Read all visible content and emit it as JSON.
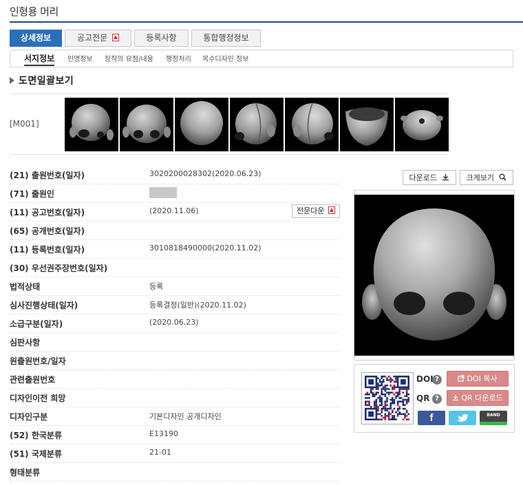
{
  "page": {
    "title": "인형용 머리"
  },
  "tabs": [
    {
      "label": "상세정보",
      "active": true
    },
    {
      "label": "공고전문",
      "has_pdf": true
    },
    {
      "label": "등록사항"
    },
    {
      "label": "통합행정정보"
    }
  ],
  "subnav": [
    {
      "label": "서지정보",
      "active": true
    },
    {
      "label": "인명정보"
    },
    {
      "label": "창작의 요점/내용"
    },
    {
      "label": "행정처리"
    },
    {
      "label": "복수디자인 정보"
    }
  ],
  "drawings": {
    "heading": "도면일괄보기",
    "label": "[M001]",
    "views": [
      "top-right",
      "front-top",
      "back",
      "right-side",
      "left-side",
      "top-down",
      "bottom"
    ]
  },
  "info": [
    {
      "label": "(21) 출원번호(일자)",
      "value": "3020200028302(2020.06.23)"
    },
    {
      "label": "(71) 출원인",
      "value": "",
      "redacted": true
    },
    {
      "label": "(11) 공고번호(일자)",
      "value": "(2020.11.06)",
      "button": "전문다운"
    },
    {
      "label": "(65) 공개번호(일자)",
      "value": ""
    },
    {
      "label": "(11) 등록번호(일자)",
      "value": "3010818490000(2020.11.02)"
    },
    {
      "label": "(30) 우선권주장번호(일자)",
      "value": ""
    },
    {
      "label": "법적상태",
      "value": "등록"
    },
    {
      "label": "심사진행상태(일자)",
      "value": "등록결정(일반)(2020.11.02)"
    },
    {
      "label": "소급구분(일자)",
      "value": "(2020.06.23)"
    },
    {
      "label": "심판사항",
      "value": ""
    },
    {
      "label": "원출원번호/일자",
      "value": ""
    },
    {
      "label": "관련출원번호",
      "value": ""
    },
    {
      "label": "디자인이전 희망",
      "value": ""
    },
    {
      "label": "디자인구분",
      "value": "기본디자인 공개디자인"
    },
    {
      "label": "(52) 한국분류",
      "value": "E13190"
    },
    {
      "label": "(51) 국제분류",
      "value": "21-01"
    },
    {
      "label": "형태분류",
      "value": ""
    }
  ],
  "actions": {
    "download": "다운로드",
    "zoom": "크게보기"
  },
  "share": {
    "doi_label": "DOI",
    "qr_label": "QR",
    "doi_button": "DOI 복사",
    "qr_button": "QR 다운로드",
    "facebook": "f",
    "band": "BAND",
    "colors": {
      "facebook": "#3b5998",
      "twitter": "#55c3ea",
      "band": "#444444",
      "accent": "#2a6fb8",
      "pink": "#d98989"
    }
  }
}
